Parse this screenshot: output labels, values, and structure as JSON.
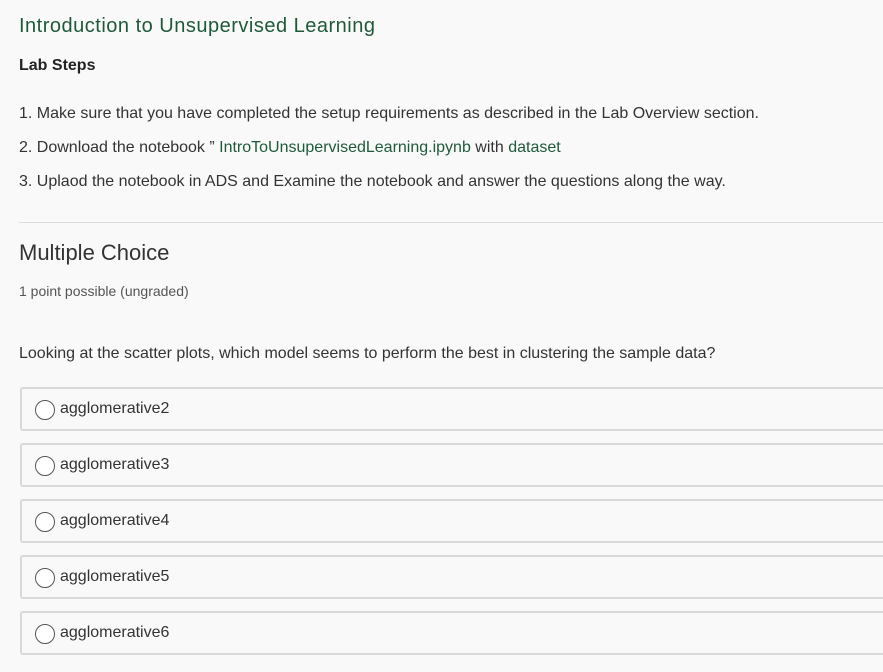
{
  "header": {
    "title": "Introduction to Unsupervised Learning",
    "lab_steps_heading": "Lab Steps"
  },
  "steps": [
    {
      "text": "1. Make sure that you have completed the setup requirements as described in the Lab Overview section."
    },
    {
      "prefix": "2. Download the notebook ” ",
      "link1": "IntroToUnsupervisedLearning.ipynb",
      "middle": " with ",
      "link2": "dataset"
    },
    {
      "text": "3. Uplaod the notebook in ADS and Examine the notebook and answer the questions along the way."
    }
  ],
  "problem": {
    "title": "Multiple Choice",
    "points": "1 point possible (ungraded)",
    "question": "Looking at the scatter plots, which model seems to perform the best in clustering the sample data?",
    "choices": [
      {
        "label": "agglomerative2"
      },
      {
        "label": "agglomerative3"
      },
      {
        "label": "agglomerative4"
      },
      {
        "label": "agglomerative5"
      },
      {
        "label": "agglomerative6"
      }
    ]
  },
  "colors": {
    "accent_link": "#1e5a3a",
    "background": "#f9f9f9",
    "choice_border": "#d9d9d9"
  }
}
